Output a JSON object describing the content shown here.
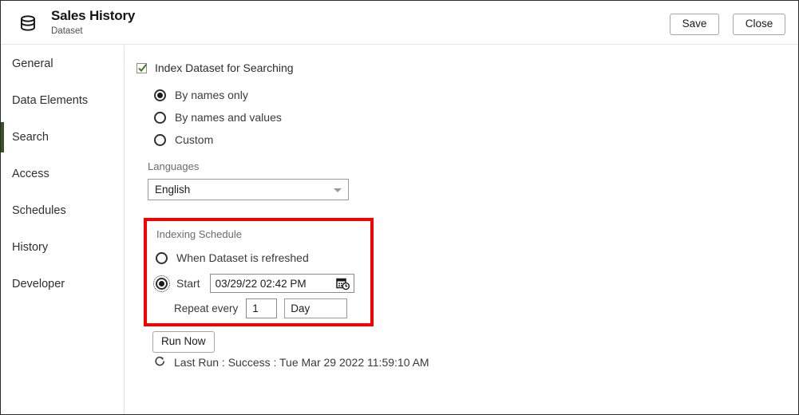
{
  "header": {
    "icon": "database-icon",
    "title": "Sales History",
    "subtitle": "Dataset",
    "save_label": "Save",
    "close_label": "Close"
  },
  "sidebar": {
    "items": [
      {
        "label": "General",
        "active": false
      },
      {
        "label": "Data Elements",
        "active": false
      },
      {
        "label": "Search",
        "active": true
      },
      {
        "label": "Access",
        "active": false
      },
      {
        "label": "Schedules",
        "active": false
      },
      {
        "label": "History",
        "active": false
      },
      {
        "label": "Developer",
        "active": false
      }
    ],
    "active_accent_color": "#3b5227"
  },
  "main": {
    "index_checkbox": {
      "label": "Index Dataset for Searching",
      "checked": true,
      "check_color": "#3e7d1e"
    },
    "index_mode": {
      "options": [
        {
          "label": "By names only",
          "selected": true
        },
        {
          "label": "By names and values",
          "selected": false
        },
        {
          "label": "Custom",
          "selected": false
        }
      ]
    },
    "languages": {
      "label": "Languages",
      "value": "English",
      "caret": "chevron-down-icon"
    },
    "indexing_schedule": {
      "title": "Indexing Schedule",
      "highlight_color": "#f60000",
      "options": [
        {
          "label": "When Dataset is refreshed",
          "selected": false
        },
        {
          "label": "Start",
          "selected": true,
          "focused": true
        }
      ],
      "start_date": {
        "value": "03/29/22 02:42 PM",
        "icon": "calendar-clock-icon"
      },
      "repeat": {
        "label": "Repeat every",
        "interval_value": "1",
        "unit_value": "Day"
      }
    },
    "run_now_label": "Run Now",
    "last_run": {
      "icon": "refresh-icon",
      "text": "Last Run : Success : Tue Mar 29 2022 11:59:10 AM"
    }
  }
}
